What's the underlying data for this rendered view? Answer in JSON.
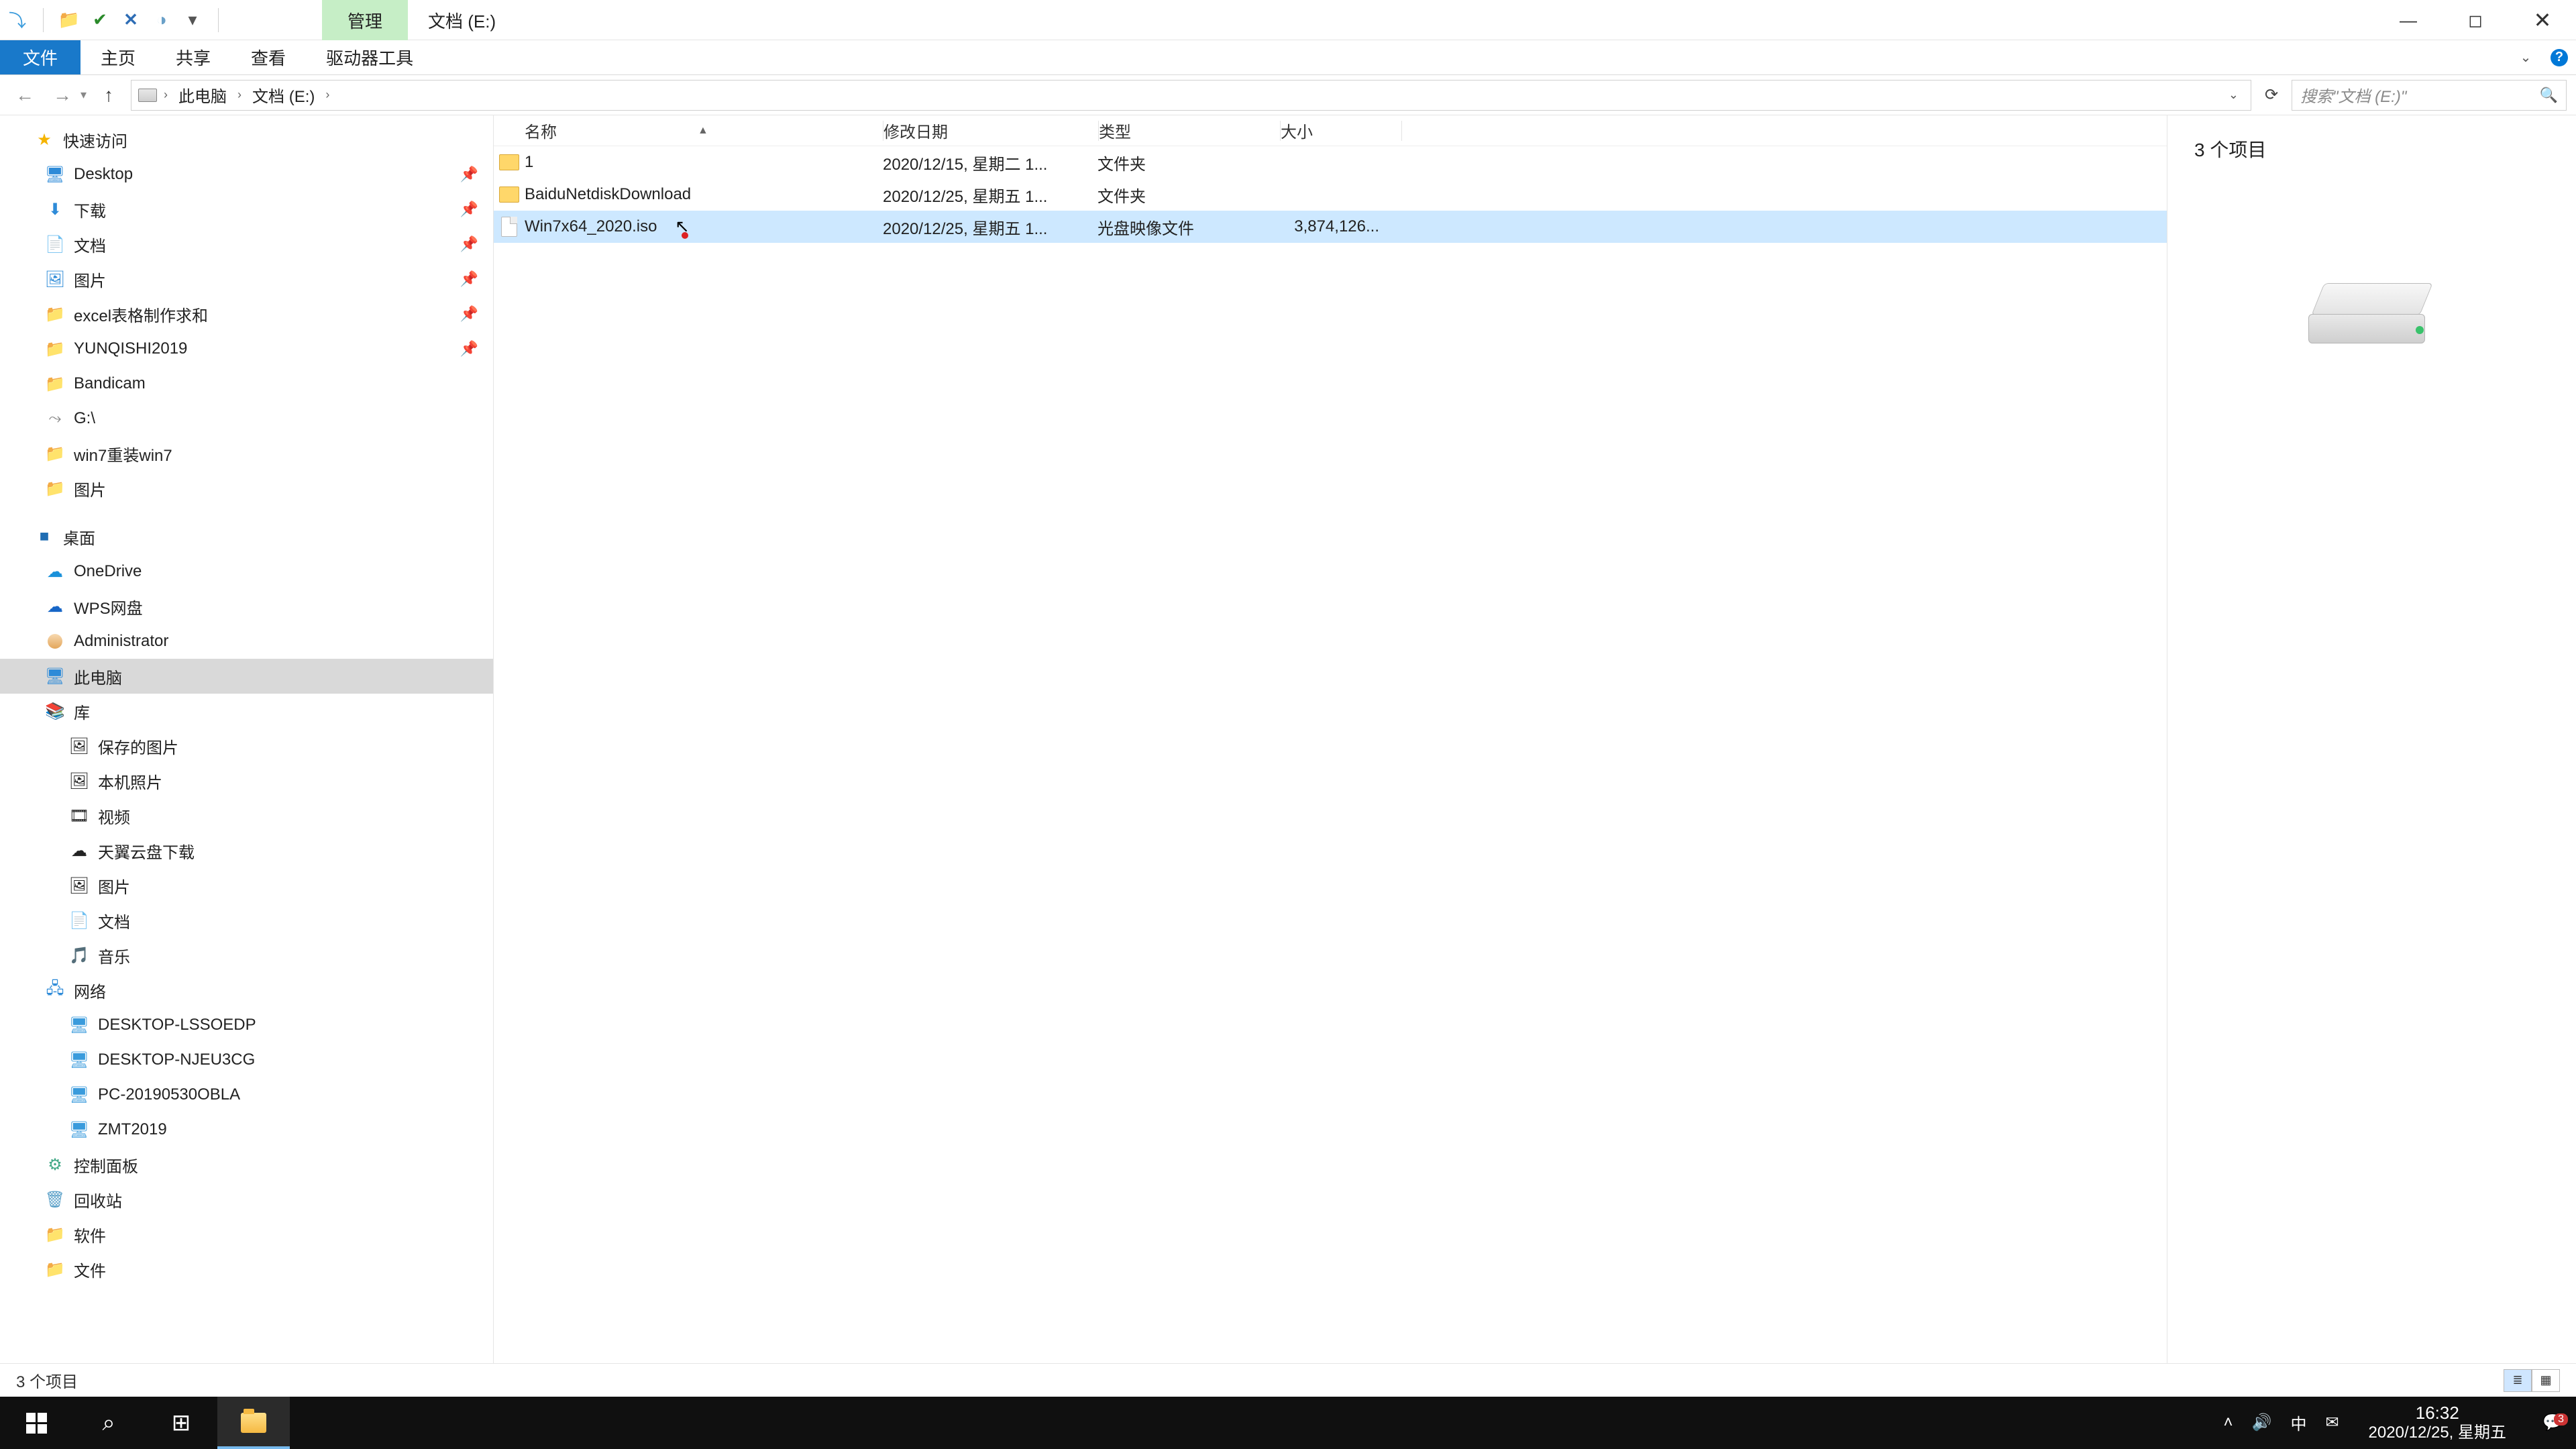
{
  "titlebar": {
    "context_tab": "管理",
    "window_title": "文档 (E:)",
    "qat_icons": [
      "app-icon",
      "folder-icon",
      "checkmark-icon",
      "close-x-icon",
      "properties-icon"
    ]
  },
  "ribbon": {
    "file": "文件",
    "tabs": [
      "主页",
      "共享",
      "查看",
      "驱动器工具"
    ]
  },
  "address": {
    "crumbs": [
      "此电脑",
      "文档 (E:)"
    ],
    "search_placeholder": "搜索\"文档 (E:)\""
  },
  "nav": {
    "quick_access": "快速访问",
    "quick_items": [
      {
        "label": "Desktop",
        "pin": true,
        "ico": "i-desktop",
        "glyph": "🖥"
      },
      {
        "label": "下载",
        "pin": true,
        "ico": "i-dl",
        "glyph": "⬇"
      },
      {
        "label": "文档",
        "pin": true,
        "ico": "i-doc",
        "glyph": "📄"
      },
      {
        "label": "图片",
        "pin": true,
        "ico": "i-pic",
        "glyph": "🖼"
      },
      {
        "label": "excel表格制作求和",
        "pin": true,
        "ico": "i-folder",
        "glyph": "📁"
      },
      {
        "label": "YUNQISHI2019",
        "pin": true,
        "ico": "i-folder",
        "glyph": "📁"
      },
      {
        "label": "Bandicam",
        "pin": false,
        "ico": "i-folder",
        "glyph": "📁"
      },
      {
        "label": "G:\\",
        "pin": false,
        "ico": "i-drive",
        "glyph": "💾"
      },
      {
        "label": "win7重装win7",
        "pin": false,
        "ico": "i-folder",
        "glyph": "📁"
      },
      {
        "label": "图片",
        "pin": false,
        "ico": "i-folder",
        "glyph": "📁"
      }
    ],
    "desktop": "桌面",
    "desktop_items": [
      {
        "label": "OneDrive",
        "ico": "i-onedrive",
        "glyph": "☁"
      },
      {
        "label": "WPS网盘",
        "ico": "i-wps",
        "glyph": "☁"
      },
      {
        "label": "Administrator",
        "ico": "i-user",
        "glyph": ""
      },
      {
        "label": "此电脑",
        "ico": "i-pc",
        "glyph": "🖥",
        "selected": true
      },
      {
        "label": "库",
        "ico": "i-lib",
        "glyph": "📚"
      }
    ],
    "lib_items": [
      {
        "label": "保存的图片",
        "glyph": "🖼"
      },
      {
        "label": "本机照片",
        "glyph": "🖼"
      },
      {
        "label": "视频",
        "glyph": "🎞"
      },
      {
        "label": "天翼云盘下载",
        "glyph": "☁"
      },
      {
        "label": "图片",
        "glyph": "🖼"
      },
      {
        "label": "文档",
        "glyph": "📄"
      },
      {
        "label": "音乐",
        "glyph": "🎵"
      }
    ],
    "network": "网络",
    "net_items": [
      "DESKTOP-LSSOEDP",
      "DESKTOP-NJEU3CG",
      "PC-20190530OBLA",
      "ZMT2019"
    ],
    "tail": [
      "控制面板",
      "回收站",
      "软件",
      "文件"
    ]
  },
  "columns": {
    "name": "名称",
    "date": "修改日期",
    "type": "类型",
    "size": "大小"
  },
  "files": [
    {
      "name": "1",
      "date": "2020/12/15, 星期二 1...",
      "type": "文件夹",
      "size": "",
      "kind": "folder"
    },
    {
      "name": "BaiduNetdiskDownload",
      "date": "2020/12/25, 星期五 1...",
      "type": "文件夹",
      "size": "",
      "kind": "folder"
    },
    {
      "name": "Win7x64_2020.iso",
      "date": "2020/12/25, 星期五 1...",
      "type": "光盘映像文件",
      "size": "3,874,126...",
      "kind": "file",
      "selected": true
    }
  ],
  "preview": {
    "count": "3 个项目"
  },
  "status": {
    "text": "3 个项目"
  },
  "taskbar": {
    "time": "16:32",
    "date": "2020/12/25, 星期五",
    "ime": "中",
    "notif_count": "3"
  }
}
